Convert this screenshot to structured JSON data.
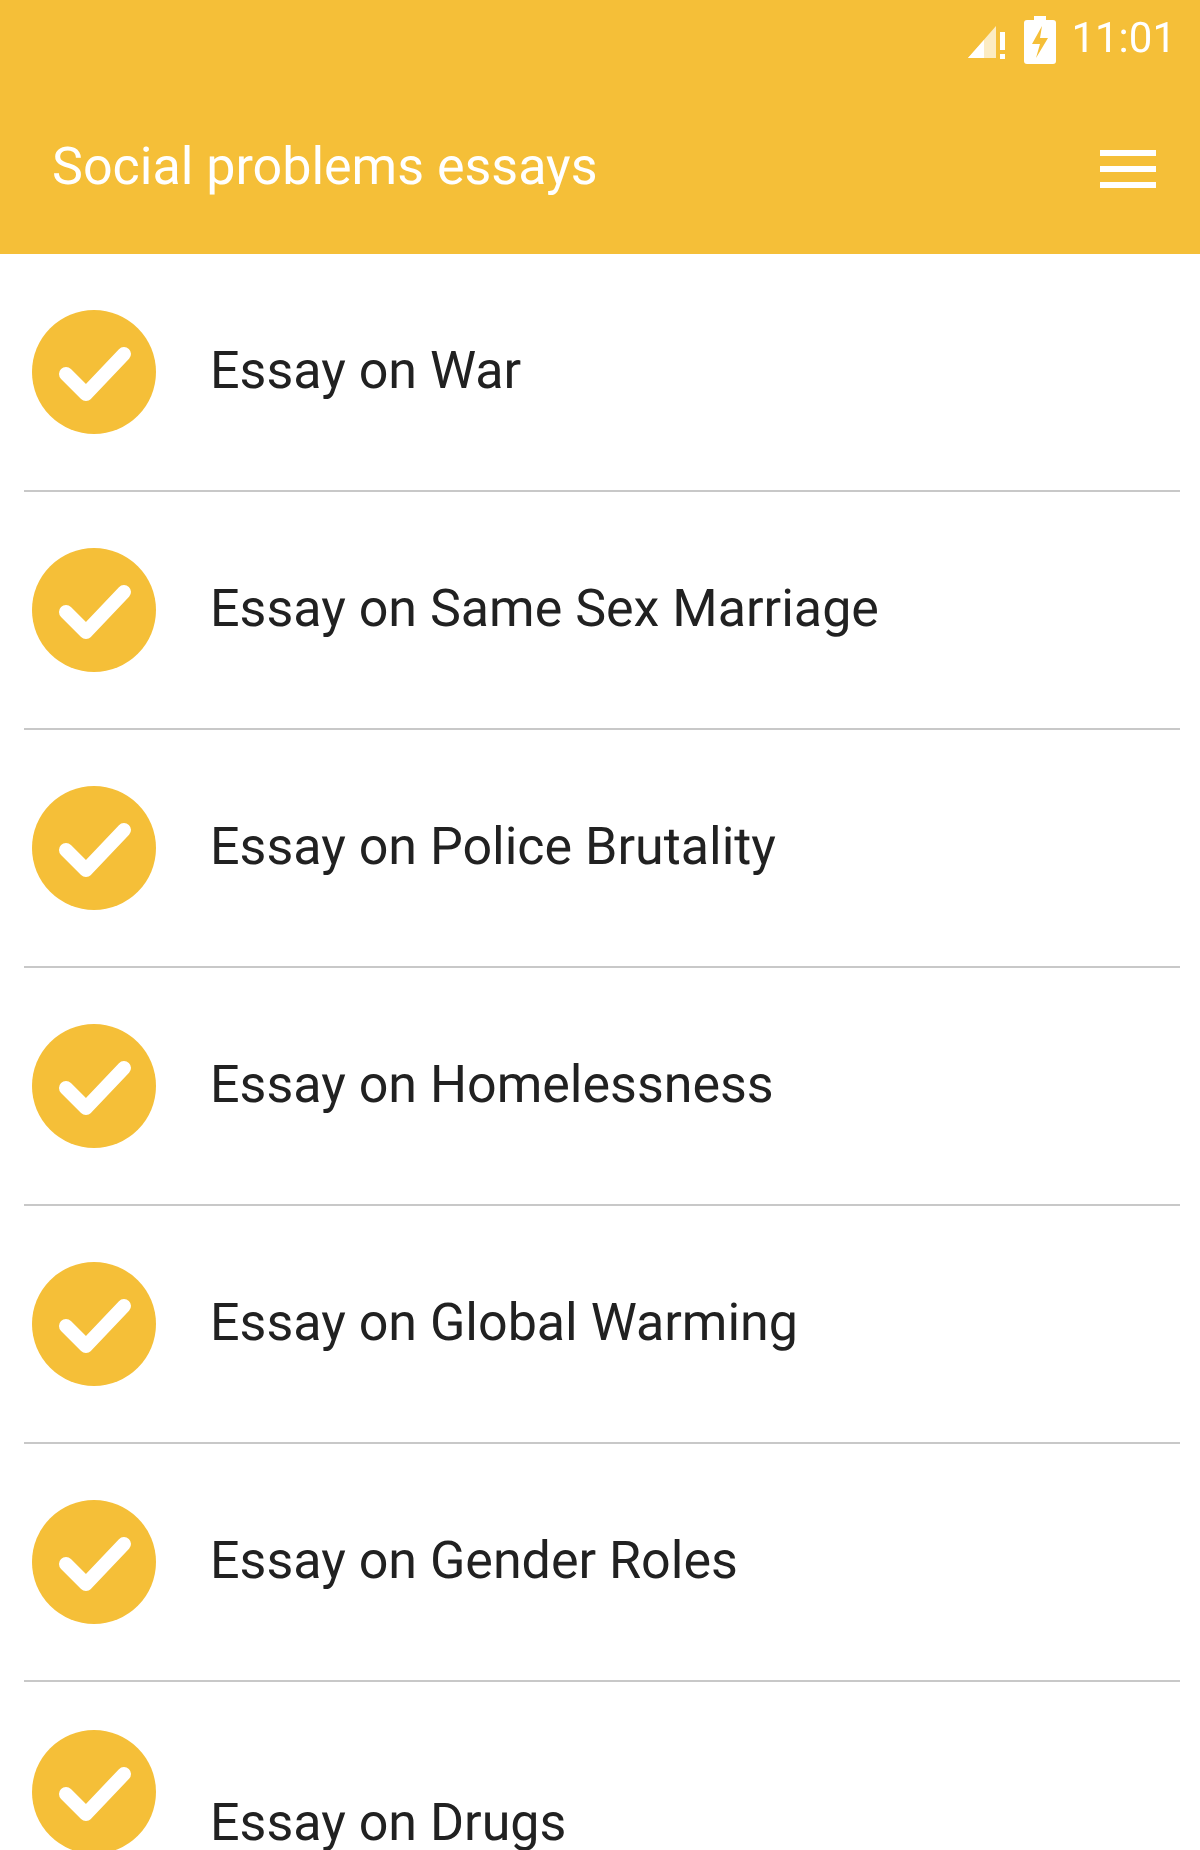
{
  "status_bar": {
    "time": "11:01"
  },
  "app_bar": {
    "title": "Social problems essays"
  },
  "items": [
    {
      "label": "Essay on War"
    },
    {
      "label": "Essay on Same Sex Marriage"
    },
    {
      "label": "Essay on Police Brutality"
    },
    {
      "label": "Essay on Homelessness"
    },
    {
      "label": "Essay on Global Warming"
    },
    {
      "label": "Essay on Gender Roles"
    },
    {
      "label": "Essay on Drugs"
    }
  ]
}
